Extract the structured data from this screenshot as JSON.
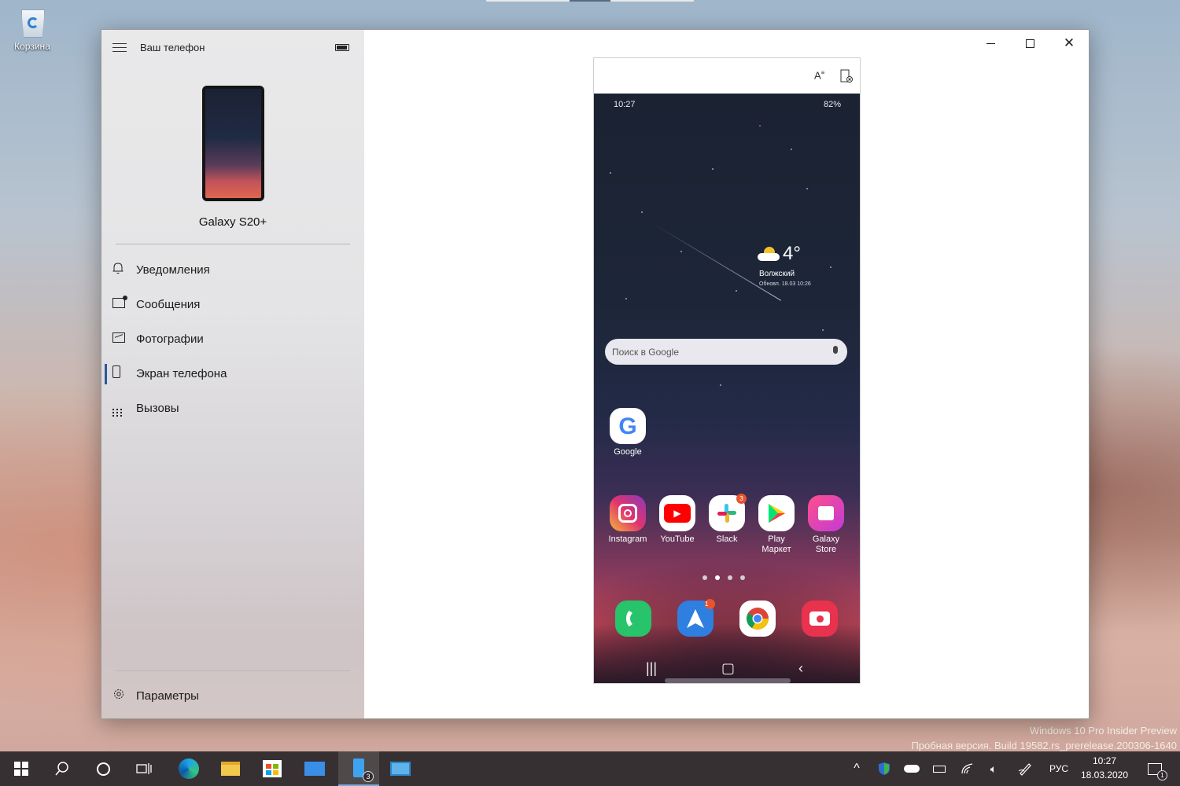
{
  "desktop": {
    "recycle_bin_label": "Корзина",
    "watermark_line1": "Windows 10 Pro Insider Preview",
    "watermark_line2": "Пробная версия. Build 19582.rs_prerelease.200306-1640"
  },
  "app": {
    "title": "Ваш телефон",
    "device_name": "Galaxy S20+",
    "nav": [
      {
        "label": "Уведомления",
        "icon": "bell-icon"
      },
      {
        "label": "Сообщения",
        "icon": "message-icon"
      },
      {
        "label": "Фотографии",
        "icon": "photos-icon"
      },
      {
        "label": "Экран телефона",
        "icon": "phone-screen-icon",
        "active": true
      },
      {
        "label": "Вызовы",
        "icon": "dialpad-icon"
      }
    ],
    "settings_label": "Параметры",
    "window_controls": {
      "close": "✕"
    }
  },
  "phone": {
    "status_time": "10:27",
    "battery": "82%",
    "weather": {
      "temperature": "4°",
      "city": "Волжский",
      "updated": "Обновл. 18.03 10:26"
    },
    "search_placeholder": "Поиск в Google",
    "apps_row1": [
      {
        "label": "Google"
      }
    ],
    "apps_row2": [
      {
        "label": "Instagram"
      },
      {
        "label": "YouTube"
      },
      {
        "label": "Slack",
        "badge": "3"
      },
      {
        "label": "Play\nМаркет"
      },
      {
        "label": "Galaxy\nStore"
      }
    ],
    "dock": [
      {
        "name": "phone-app",
        "color": "#27c46b"
      },
      {
        "name": "spark-app",
        "color": "#2e7fe0",
        "badge": "1"
      },
      {
        "name": "chrome-app",
        "color": "#ffffff"
      },
      {
        "name": "camera-app",
        "color": "#e8324e"
      }
    ]
  },
  "taskbar": {
    "language": "РУС",
    "time": "10:27",
    "date": "18.03.2020",
    "your_phone_badge": "3",
    "notification_badge": "1"
  }
}
